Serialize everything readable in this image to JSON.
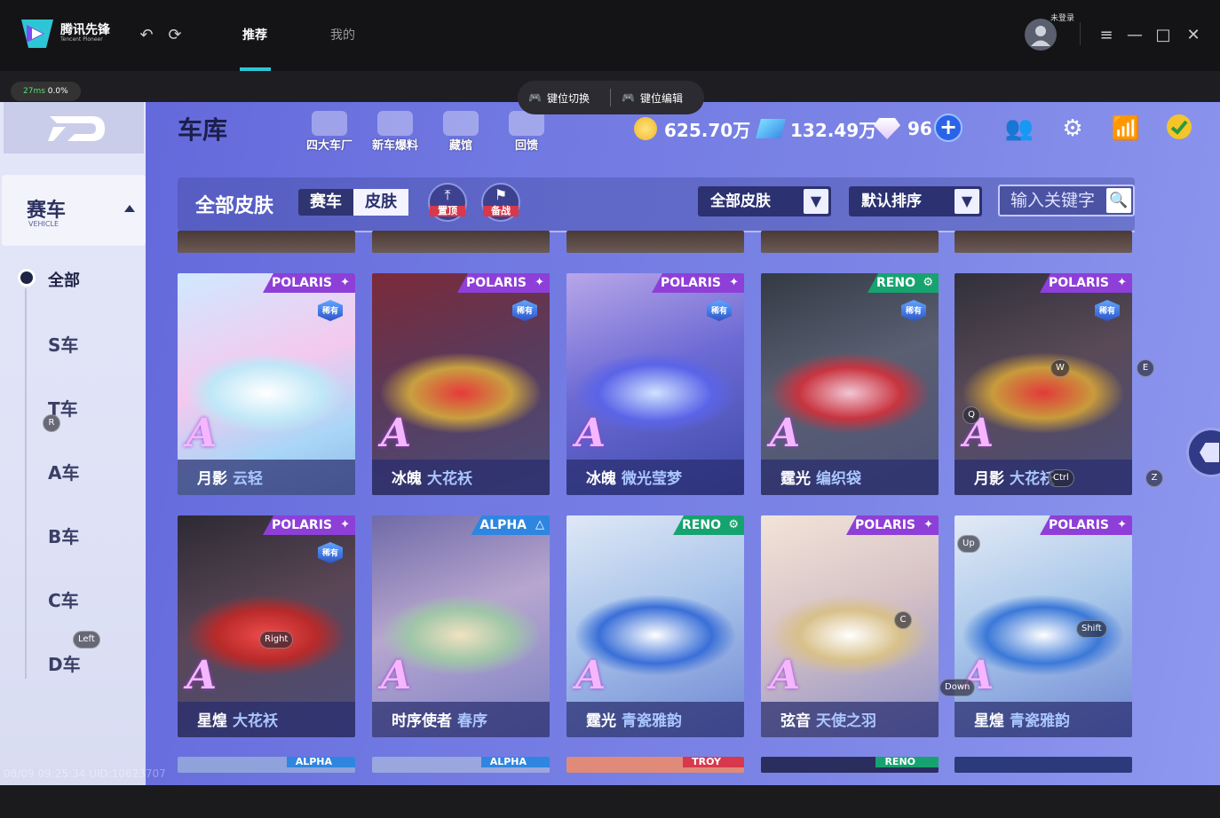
{
  "launcher": {
    "logo_cn": "腾讯先锋",
    "logo_en": "Tencent Pioneer",
    "tabs": [
      "推荐",
      "我的"
    ],
    "login_text": "未登录",
    "ping": "27ms",
    "loss": "0.0%",
    "key_switch": "键位切换",
    "key_edit": "键位编辑",
    "accent": "#2ec6d4",
    "icons": [
      "undo-icon",
      "refresh-icon",
      "menu-icon",
      "minimize-icon",
      "maximize-icon",
      "close-icon"
    ]
  },
  "game": {
    "title": "车库",
    "nav": [
      "四大车厂",
      "新车爆料",
      "藏馆",
      "回馈"
    ],
    "currency": {
      "coins": "625.70万",
      "tickets": "132.49万",
      "diamonds": "96"
    },
    "sidebar": {
      "category_cn": "赛车",
      "category_en": "VEHICLE",
      "all": "全部",
      "items": [
        "S车",
        "T车",
        "A车",
        "B车",
        "C车",
        "D车"
      ]
    },
    "filter": {
      "title": "全部皮肤",
      "seg": [
        "赛车",
        "皮肤"
      ],
      "pin": "置顶",
      "battle": "备战",
      "dd1": "全部皮肤",
      "dd2": "默认排序",
      "search_placeholder": "输入关键字"
    },
    "grade": "A",
    "rare": "稀有",
    "row1": [
      {
        "model": "月影",
        "skin": "云轻",
        "brand": "POLARIS",
        "rare": true
      },
      {
        "model": "冰魄",
        "skin": "大花袄",
        "brand": "POLARIS",
        "rare": true
      },
      {
        "model": "冰魄",
        "skin": "微光莹梦",
        "brand": "POLARIS",
        "rare": true
      },
      {
        "model": "霆光",
        "skin": "编织袋",
        "brand": "RENO",
        "rare": true
      },
      {
        "model": "月影",
        "skin": "大花袄",
        "brand": "POLARIS",
        "rare": true
      }
    ],
    "row2": [
      {
        "model": "星煌",
        "skin": "大花袄",
        "brand": "POLARIS",
        "rare": true
      },
      {
        "model": "时序使者",
        "skin": "春序",
        "brand": "ALPHA",
        "rare": false
      },
      {
        "model": "霆光",
        "skin": "青瓷雅韵",
        "brand": "RENO",
        "rare": false
      },
      {
        "model": "弦音",
        "skin": "天使之羽",
        "brand": "POLARIS",
        "rare": false
      },
      {
        "model": "星煌",
        "skin": "青瓷雅韵",
        "brand": "POLARIS",
        "rare": false
      }
    ],
    "row3_brands": [
      "ALPHA",
      "ALPHA",
      "TROY",
      "RENO",
      ""
    ],
    "keys": [
      "E",
      "R",
      "W",
      "Q",
      "Ctrl",
      "Z",
      "Up",
      "C",
      "Shift",
      "Right",
      "Left",
      "Down"
    ],
    "watermark": "08/09 09:25:34 UID:10623707"
  }
}
